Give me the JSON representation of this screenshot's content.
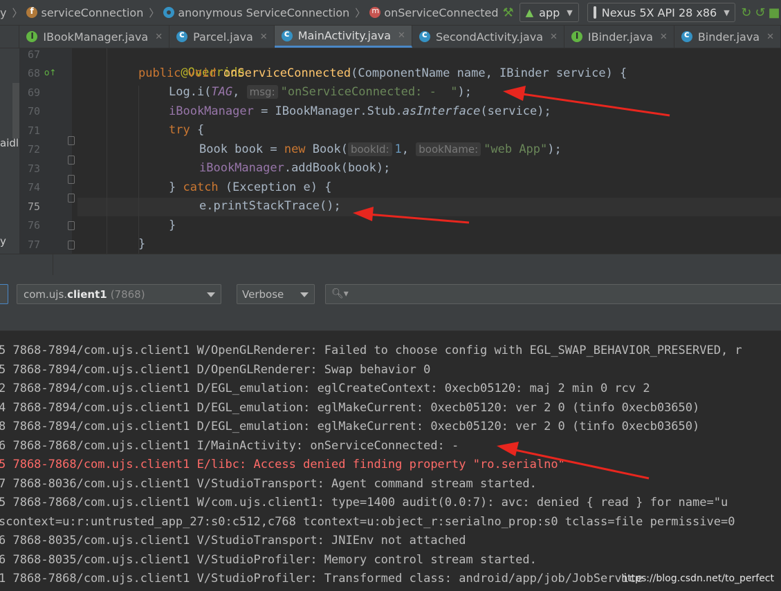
{
  "breadcrumb": {
    "items": [
      {
        "label": "y",
        "icon": "none"
      },
      {
        "label": "serviceConnection",
        "icon": "field-icon"
      },
      {
        "label": "anonymous ServiceConnection",
        "icon": "anonymous-class-icon"
      },
      {
        "label": "onServiceConnected",
        "icon": "method-icon"
      }
    ]
  },
  "run_config": {
    "module": "app",
    "device": "Nexus 5X API 28 x86"
  },
  "tabs": [
    {
      "label": "IBookManager.java",
      "icon": "interface-icon",
      "active": false
    },
    {
      "label": "Parcel.java",
      "icon": "class-icon",
      "active": false
    },
    {
      "label": "MainActivity.java",
      "icon": "class-icon",
      "active": true
    },
    {
      "label": "SecondActivity.java",
      "icon": "class-icon",
      "active": false
    },
    {
      "label": "IBinder.java",
      "icon": "interface-icon",
      "active": false
    },
    {
      "label": "Binder.java",
      "icon": "class-icon",
      "active": false
    }
  ],
  "side_panel": {
    "label_top": "aidl",
    "label_bottom": "y"
  },
  "editor": {
    "line_numbers": [
      "67",
      "68",
      "69",
      "70",
      "71",
      "72",
      "73",
      "74",
      "75",
      "76",
      "77"
    ],
    "current_line": "75",
    "code": {
      "l67_annotation": "@Override",
      "l68_public": "public",
      "l68_void": "void",
      "l68_method": "onServiceConnected",
      "l68_rest": "(ComponentName name, IBinder service) {",
      "l69_call": "Log.i(",
      "l69_tag": "TAG",
      "l69_comma": ", ",
      "l69_hint": "msg:",
      "l69_string": "\"onServiceConnected: -  \"",
      "l69_end": ");",
      "l70_field": "iBookManager",
      "l70_mid": " = IBookManager.Stub.",
      "l70_italic": "asInterface",
      "l70_end": "(service);",
      "l71_try": "try",
      "l71_brace": " {",
      "l72_start": "Book book = ",
      "l72_new": "new",
      "l72_ctor": " Book(",
      "l72_hint1": "bookId:",
      "l72_num": "1",
      "l72_comma": ", ",
      "l72_hint2": "bookName:",
      "l72_string": "\"web App\"",
      "l72_end": ");",
      "l73_field": "iBookManager",
      "l73_end": ".addBook(book);",
      "l74_open": "} ",
      "l74_catch": "catch",
      "l74_end": " (Exception e) {",
      "l75_call": "e.printStackTrace();",
      "l76_close": "}",
      "l77_close": "}"
    }
  },
  "logcat": {
    "process_package_prefix": "com.ujs.",
    "process_package_bold": "client1",
    "process_pid": "(7868)",
    "log_level": "Verbose",
    "search_placeholder": ""
  },
  "log_lines": [
    {
      "text": "5 7868-7894/com.ujs.client1 W/OpenGLRenderer: Failed to choose config with EGL_SWAP_BEHAVIOR_PRESERVED, r",
      "level": "W"
    },
    {
      "text": "5 7868-7894/com.ujs.client1 D/OpenGLRenderer: Swap behavior 0",
      "level": "D"
    },
    {
      "text": "2 7868-7894/com.ujs.client1 D/EGL_emulation: eglCreateContext: 0xecb05120: maj 2 min 0 rcv 2",
      "level": "D"
    },
    {
      "text": "4 7868-7894/com.ujs.client1 D/EGL_emulation: eglMakeCurrent: 0xecb05120: ver 2 0 (tinfo 0xecb03650)",
      "level": "D"
    },
    {
      "text": "8 7868-7894/com.ujs.client1 D/EGL_emulation: eglMakeCurrent: 0xecb05120: ver 2 0 (tinfo 0xecb03650)",
      "level": "D"
    },
    {
      "text": "6 7868-7868/com.ujs.client1 I/MainActivity: onServiceConnected: -",
      "level": "I"
    },
    {
      "text": "5 7868-7868/com.ujs.client1 E/libc: Access denied finding property \"ro.serialno\"",
      "level": "E"
    },
    {
      "text": "7 7868-8036/com.ujs.client1 V/StudioTransport: Agent command stream started.",
      "level": "V"
    },
    {
      "text": "5 7868-7868/com.ujs.client1 W/com.ujs.client1: type=1400 audit(0.0:7): avc: denied { read } for name=\"u",
      "level": "W"
    },
    {
      "text": "scontext=u:r:untrusted_app_27:s0:c512,c768 tcontext=u:object_r:serialno_prop:s0 tclass=file permissive=0",
      "level": "W"
    },
    {
      "text": "6 7868-8035/com.ujs.client1 V/StudioTransport: JNIEnv not attached",
      "level": "V"
    },
    {
      "text": "6 7868-8035/com.ujs.client1 V/StudioProfiler: Memory control stream started.",
      "level": "V"
    },
    {
      "text": "1 7868-7868/com.ujs.client1 V/StudioProfiler: Transformed class: android/app/job/JobService",
      "level": "V"
    }
  ],
  "watermark": "https://blog.csdn.net/to_perfect",
  "colors": {
    "error": "#ff6b68",
    "keyword": "#cc7832",
    "method": "#ffc66d",
    "string": "#6a8759",
    "annotation_arrow": "#e8261e"
  }
}
